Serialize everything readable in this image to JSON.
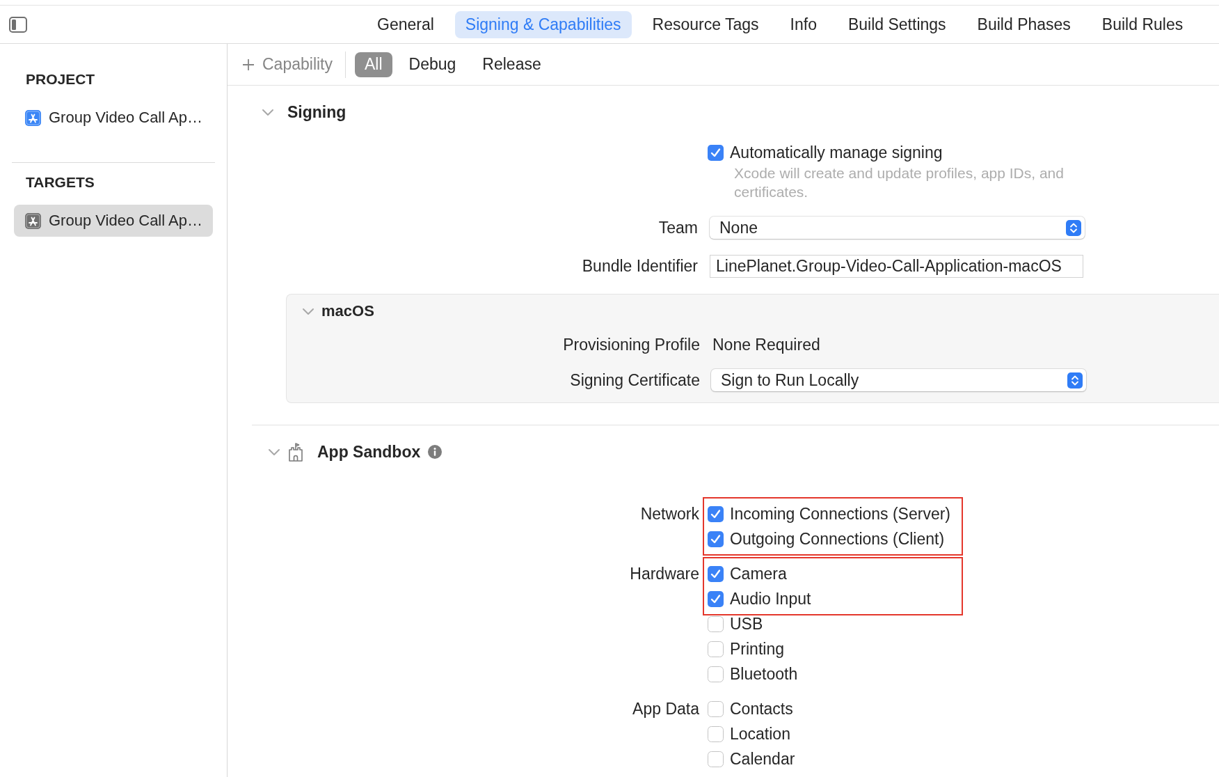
{
  "tabs": [
    {
      "label": "General",
      "selected": false
    },
    {
      "label": "Signing & Capabilities",
      "selected": true
    },
    {
      "label": "Resource Tags",
      "selected": false
    },
    {
      "label": "Info",
      "selected": false
    },
    {
      "label": "Build Settings",
      "selected": false
    },
    {
      "label": "Build Phases",
      "selected": false
    },
    {
      "label": "Build Rules",
      "selected": false
    }
  ],
  "sidebar": {
    "sections": [
      {
        "title": "PROJECT",
        "items": [
          {
            "kind": "project",
            "label": "Group Video Call Ap…",
            "selected": false
          }
        ]
      },
      {
        "title": "TARGETS",
        "items": [
          {
            "kind": "target",
            "label": "Group Video Call Ap…",
            "selected": true
          }
        ]
      }
    ]
  },
  "toolbar": {
    "add_capability": "Capability",
    "filters": [
      {
        "label": "All",
        "selected": true
      },
      {
        "label": "Debug",
        "selected": false
      },
      {
        "label": "Release",
        "selected": false
      }
    ]
  },
  "signing": {
    "title": "Signing",
    "expanded": true,
    "auto_manage": {
      "label": "Automatically manage signing",
      "checked": true,
      "note": "Xcode will create and update profiles, app IDs, and certificates."
    },
    "fields": [
      {
        "kind": "popup",
        "label": "Team",
        "value": "None"
      },
      {
        "kind": "text",
        "label": "Bundle Identifier",
        "value": "LinePlanet.Group-Video-Call-Application-macOS"
      }
    ],
    "platform": {
      "title": "macOS",
      "expanded": true,
      "fields": [
        {
          "kind": "static",
          "label": "Provisioning Profile",
          "value": "None Required"
        },
        {
          "kind": "popup",
          "label": "Signing Certificate",
          "value": "Sign to Run Locally"
        }
      ]
    }
  },
  "app_sandbox": {
    "title": "App Sandbox",
    "expanded": true,
    "groups": [
      {
        "label": "Network",
        "options": [
          {
            "label": "Incoming Connections (Server)",
            "checked": true,
            "highlighted": true
          },
          {
            "label": "Outgoing Connections (Client)",
            "checked": true,
            "highlighted": true
          }
        ]
      },
      {
        "label": "Hardware",
        "options": [
          {
            "label": "Camera",
            "checked": true,
            "highlighted": true
          },
          {
            "label": "Audio Input",
            "checked": true,
            "highlighted": true
          },
          {
            "label": "USB",
            "checked": false,
            "highlighted": false
          },
          {
            "label": "Printing",
            "checked": false,
            "highlighted": false
          },
          {
            "label": "Bluetooth",
            "checked": false,
            "highlighted": false
          }
        ]
      },
      {
        "label": "App Data",
        "options": [
          {
            "label": "Contacts",
            "checked": false,
            "highlighted": false
          },
          {
            "label": "Location",
            "checked": false,
            "highlighted": false
          },
          {
            "label": "Calendar",
            "checked": false,
            "highlighted": false
          }
        ]
      }
    ]
  }
}
